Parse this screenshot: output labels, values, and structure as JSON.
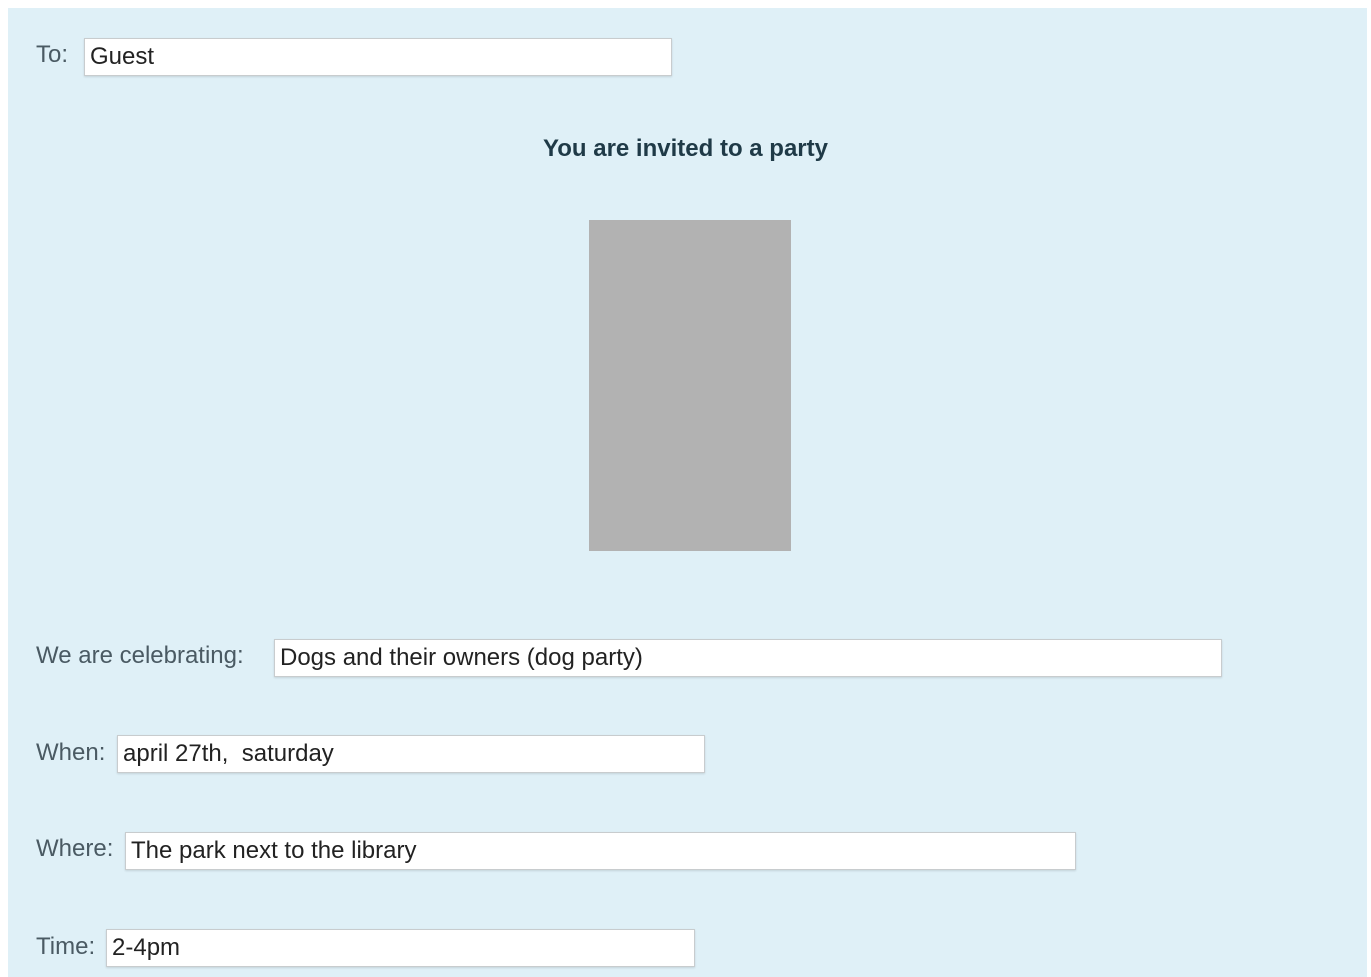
{
  "invitation": {
    "to": {
      "label": "To:",
      "value": "Guest"
    },
    "title": "You are invited to a party",
    "celebrating": {
      "label": "We are celebrating:",
      "value": "Dogs and their owners (dog party)"
    },
    "when": {
      "label": "When:",
      "value": "april 27th,  saturday"
    },
    "where": {
      "label": "Where:",
      "value": "The park next to the library"
    },
    "time": {
      "label": "Time:",
      "value": "2-4pm"
    }
  },
  "colors": {
    "background": "#dff0f7",
    "image_placeholder": "#b2b2b2"
  }
}
